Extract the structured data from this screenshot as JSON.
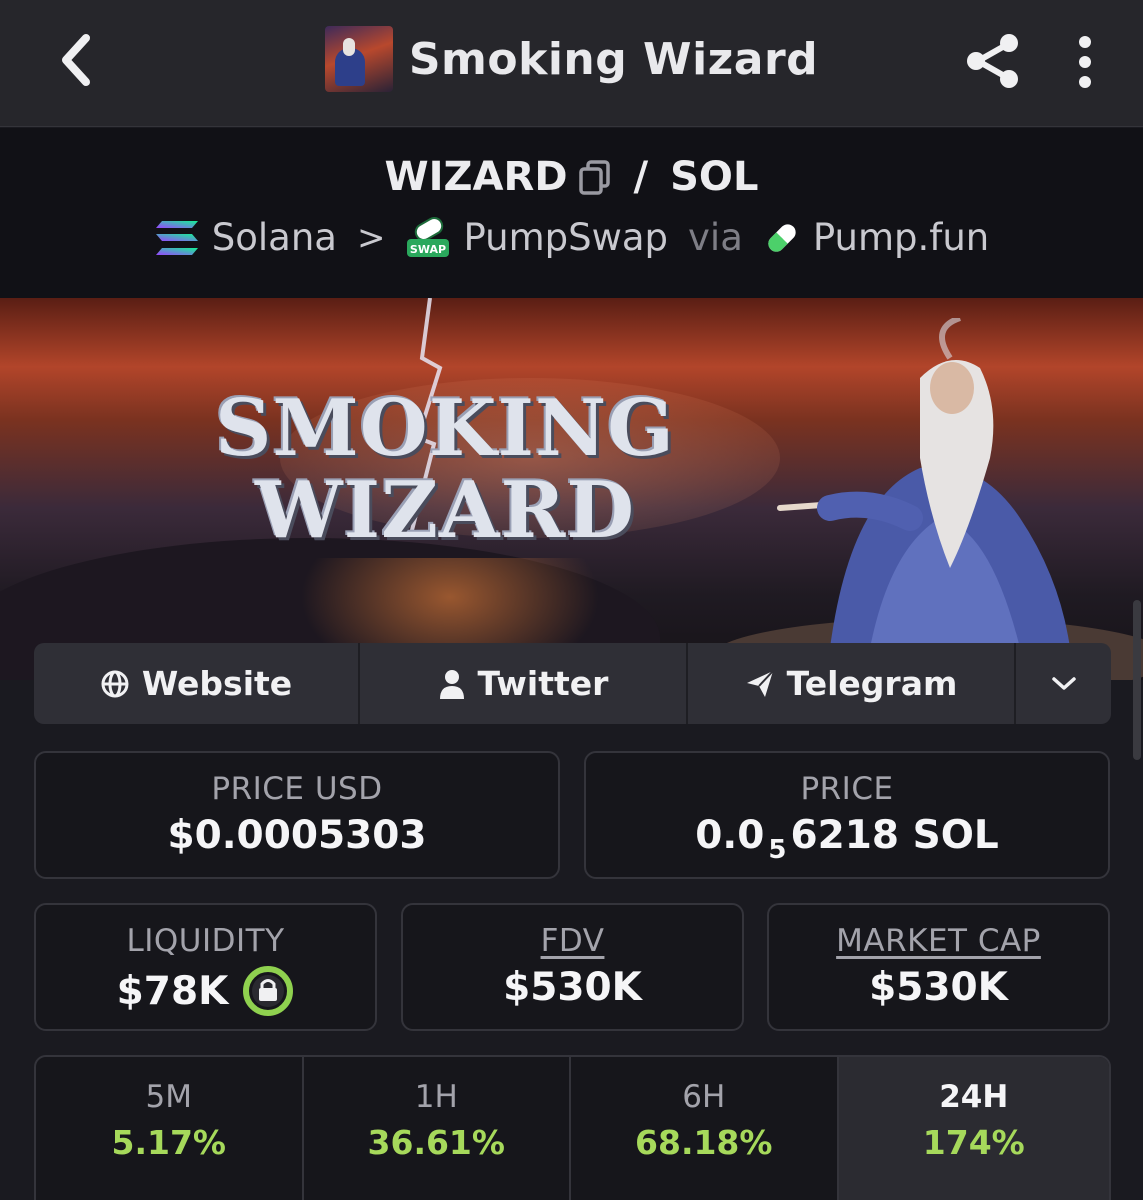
{
  "header": {
    "title": "Smoking Wizard"
  },
  "pair": {
    "base": "WIZARD",
    "divider": "/",
    "quote": "SOL"
  },
  "route": {
    "chain": "Solana",
    "separator": ">",
    "dex": "PumpSwap",
    "via": "via",
    "launchpad": "Pump.fun",
    "dex_badge": "SWAP"
  },
  "banner": {
    "line1": "SMOKING",
    "line2": "WIZARD"
  },
  "links": {
    "website": "Website",
    "twitter": "Twitter",
    "telegram": "Telegram"
  },
  "stats": {
    "price_usd_label": "PRICE USD",
    "price_usd_value": "$0.0005303",
    "price_label": "PRICE",
    "price_prefix": "0.0",
    "price_zeros": "5",
    "price_digits": "6218 SOL",
    "liquidity_label": "LIQUIDITY",
    "liquidity_value": "$78K",
    "fdv_label": "FDV",
    "fdv_value": "$530K",
    "mcap_label": "MARKET CAP",
    "mcap_value": "$530K"
  },
  "changes": [
    {
      "period": "5M",
      "value": "5.17%"
    },
    {
      "period": "1H",
      "value": "36.61%"
    },
    {
      "period": "6H",
      "value": "68.18%"
    },
    {
      "period": "24H",
      "value": "174%"
    }
  ],
  "colors": {
    "positive": "#a6d95b",
    "background": "#1a1a20",
    "lock_ring": "#8fd14f"
  },
  "icons": {
    "back": "chevron-left-icon",
    "share": "share-icon",
    "more": "more-vertical-icon",
    "copy": "copy-icon",
    "solana": "solana-logo-icon",
    "pumpswap": "pumpswap-logo-icon",
    "pumpfun": "pill-icon",
    "globe": "globe-icon",
    "user": "user-icon",
    "telegram": "paper-plane-icon",
    "expand": "chevron-down-icon",
    "lock": "lock-icon"
  }
}
